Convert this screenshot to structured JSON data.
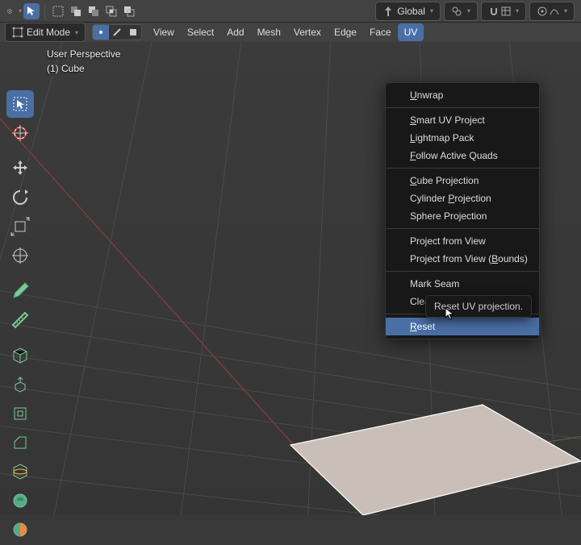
{
  "topbar": {
    "orientation_label": "Global"
  },
  "menubar": {
    "mode": "Edit Mode",
    "items": [
      "View",
      "Select",
      "Add",
      "Mesh",
      "Vertex",
      "Edge",
      "Face",
      "UV"
    ],
    "active_index": 7
  },
  "viewport": {
    "info_line1": "User Perspective",
    "info_line2": "(1) Cube"
  },
  "uv_menu": {
    "groups": [
      [
        "<u>U</u>nwrap"
      ],
      [
        "<u>S</u>mart UV Project",
        "<u>L</u>ightmap Pack",
        "<u>F</u>ollow Active Quads"
      ],
      [
        "<u>C</u>ube Projection",
        "Cylinder <u>P</u>rojection",
        "Sphere Projection"
      ],
      [
        "Project from View",
        "Project from View (<u>B</u>ounds)"
      ],
      [
        "Mark Seam",
        "Clear Seam"
      ],
      [
        "<u>R</u>eset"
      ]
    ],
    "highlighted": "Reset"
  },
  "tooltip": "Reset UV projection.",
  "tools": [
    "select-box",
    "cursor-3d",
    "",
    "move",
    "rotate",
    "scale",
    "transform",
    "",
    "annotate",
    "measure",
    "",
    "add-cube",
    "extrude-region",
    "inset-faces",
    "bevel",
    "loop-cut",
    "knife",
    "poly-build"
  ]
}
